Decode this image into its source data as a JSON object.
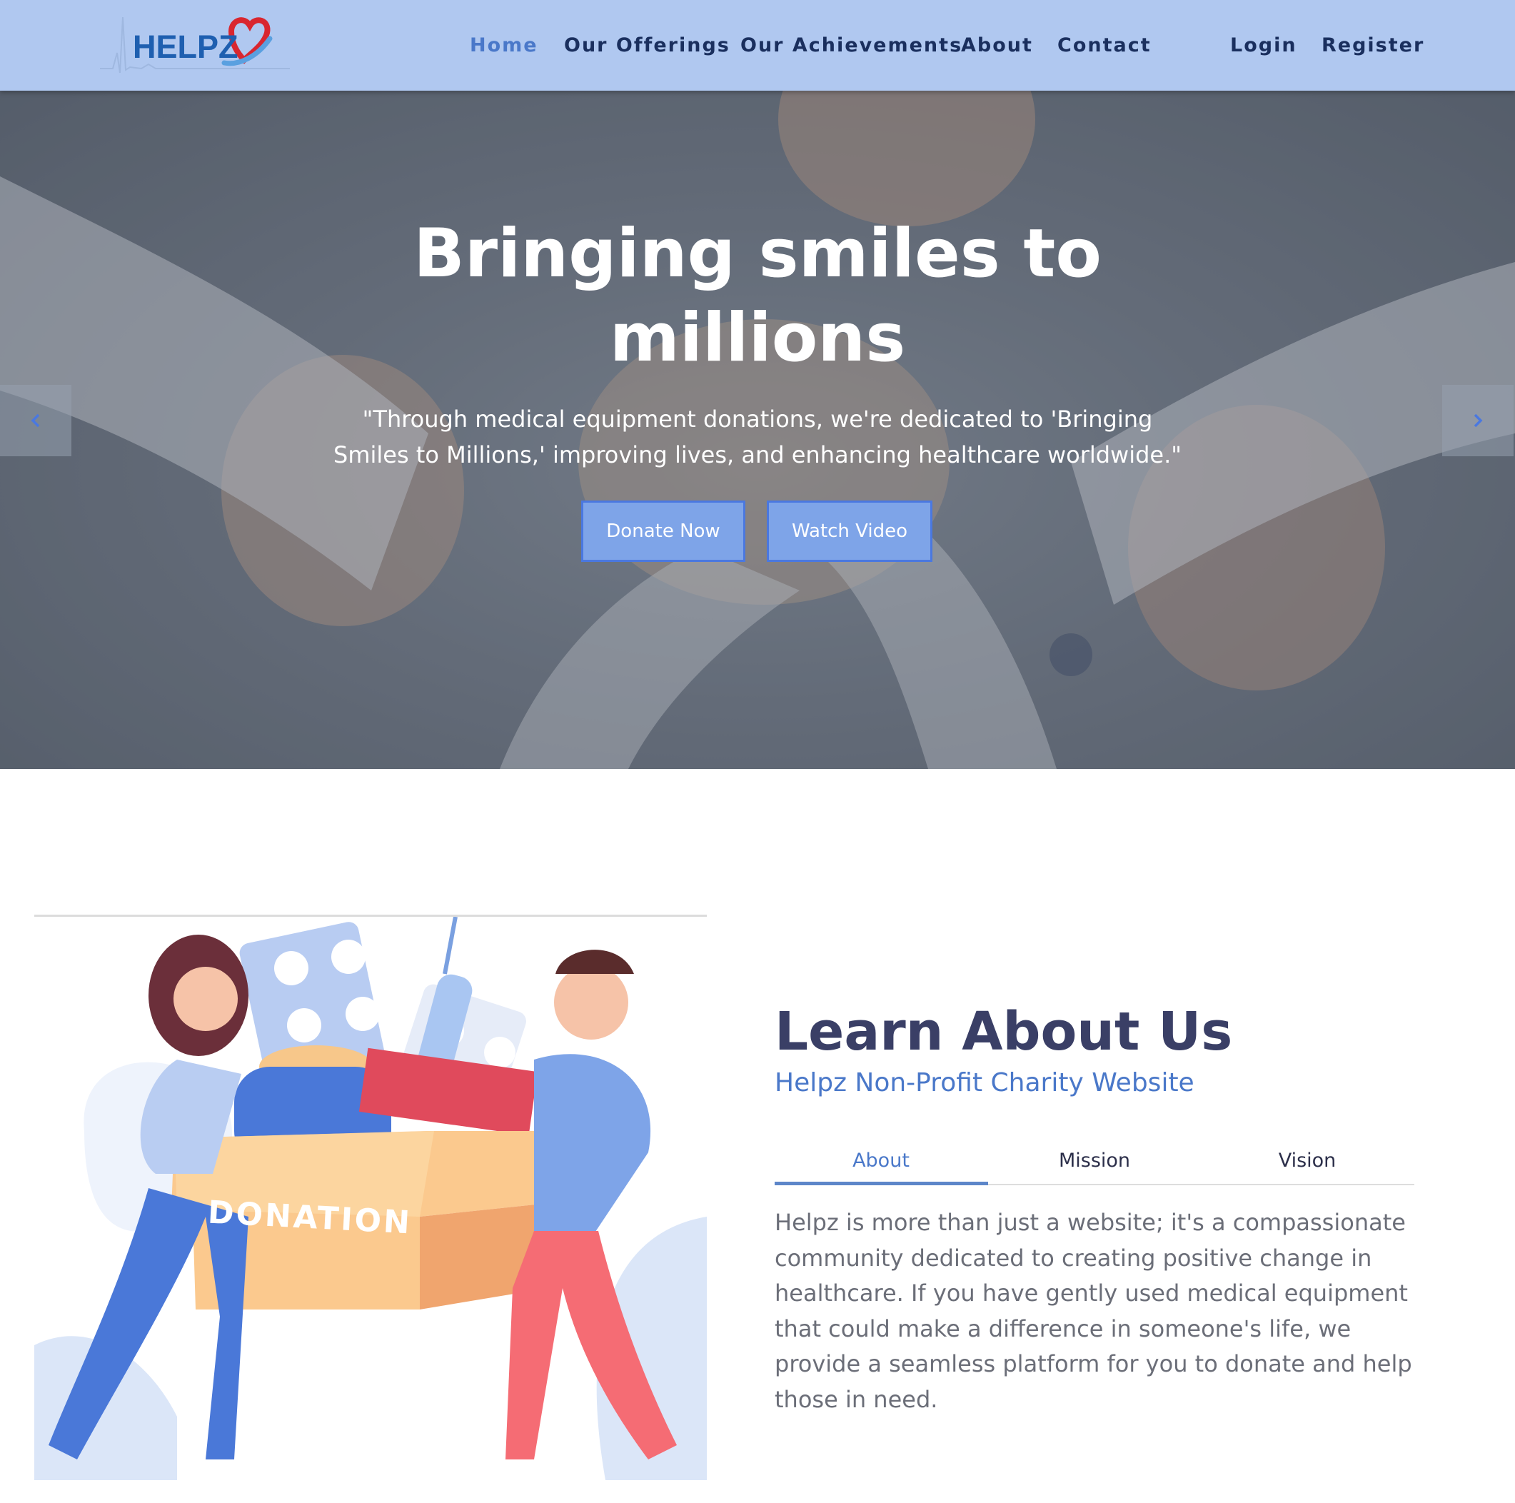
{
  "brand": {
    "logo_text": "HELPZ"
  },
  "nav": {
    "home": "Home",
    "offerings": "Our Offerings",
    "achievements": "Our Achievements",
    "about": "About",
    "contact": "Contact",
    "login": "Login",
    "register": "Register"
  },
  "hero": {
    "title": "Bringing smiles to millions",
    "quote": "\"Through medical equipment donations, we're dedicated to 'Bringing Smiles to Millions,' improving lives, and enhancing healthcare worldwide.\"",
    "donate_label": "Donate Now",
    "video_label": "Watch Video",
    "prev_icon": "chevron-left-icon",
    "next_icon": "chevron-right-icon"
  },
  "about": {
    "image_label": "DONATION",
    "title": "Learn About Us",
    "subtitle": "Helpz Non-Profit Charity Website",
    "tabs": [
      "About",
      "Mission",
      "Vision"
    ],
    "active_tab": "About",
    "text": "Helpz is more than just a website; it's a compassionate community dedicated to creating positive change in healthcare. If you have gently used medical equipment that could make a difference in someone's life, we provide a seamless platform for you to donate and help those in need."
  },
  "colors": {
    "navbar_bg": "#b0c8f0",
    "nav_text": "#1a2f5e",
    "accent": "#4a78c9",
    "button_bg": "#7ea4e8",
    "title_dark": "#3a3f66"
  }
}
